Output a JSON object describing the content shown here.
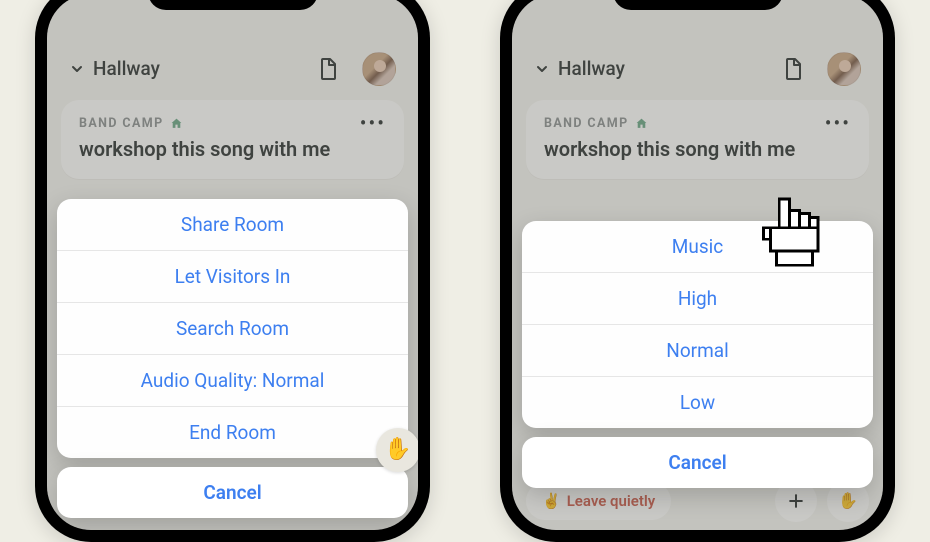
{
  "header": {
    "title": "Hallway"
  },
  "room": {
    "club": "BAND CAMP",
    "title": "workshop this song with me"
  },
  "leave_label": "Leave quietly",
  "left_sheet": {
    "items": [
      "Share Room",
      "Let Visitors In",
      "Search Room",
      "Audio Quality: Normal",
      "End Room"
    ],
    "cancel": "Cancel"
  },
  "right_sheet": {
    "items": [
      "Music",
      "High",
      "Normal",
      "Low"
    ],
    "cancel": "Cancel"
  }
}
